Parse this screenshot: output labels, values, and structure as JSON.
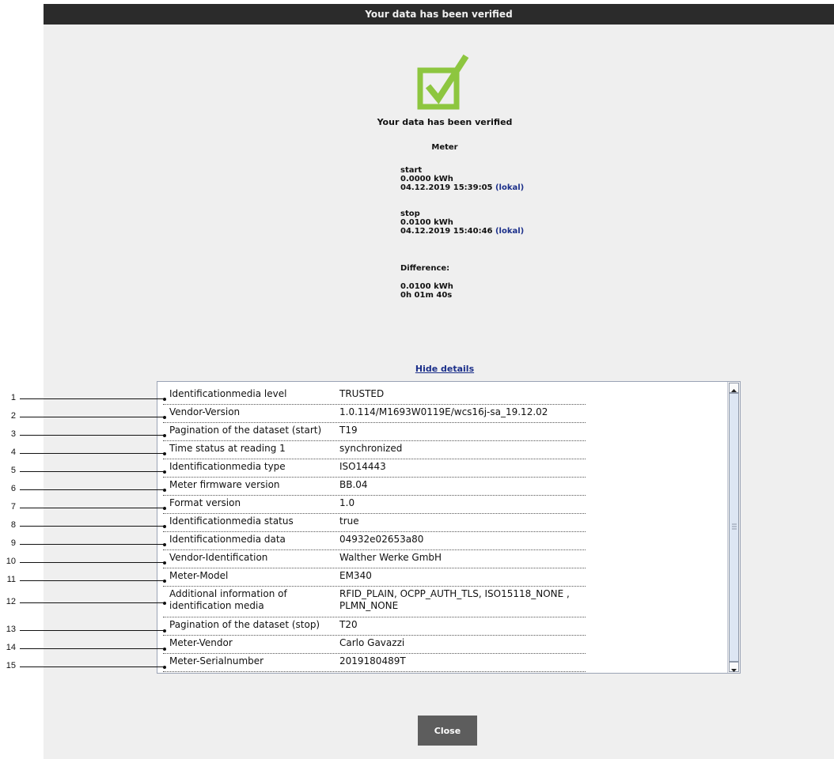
{
  "window": {
    "title": "Your data has been verified"
  },
  "verification": {
    "status_text": "Your data has been verified",
    "meter_heading": "Meter",
    "start": {
      "label": "start",
      "value": "0.0000 kWh",
      "timestamp": "04.12.2019 15:39:05",
      "tz": "(lokal)"
    },
    "stop": {
      "label": "stop",
      "value": "0.0100 kWh",
      "timestamp": "04.12.2019 15:40:46",
      "tz": "(lokal)"
    },
    "difference": {
      "label": "Difference:",
      "energy": "0.0100 kWh",
      "duration": "0h 01m 40s"
    }
  },
  "details": {
    "toggle_label": "Hide details",
    "rows": [
      {
        "label": "Identificationmedia level",
        "value": "TRUSTED"
      },
      {
        "label": "Vendor-Version",
        "value": "1.0.114/M1693W0119E/wcs16j-sa_19.12.02"
      },
      {
        "label": "Pagination of the dataset (start)",
        "value": "T19"
      },
      {
        "label": "Time status at reading 1",
        "value": "synchronized"
      },
      {
        "label": "Identificationmedia type",
        "value": "ISO14443"
      },
      {
        "label": "Meter firmware version",
        "value": "BB.04"
      },
      {
        "label": "Format version",
        "value": "1.0"
      },
      {
        "label": "Identificationmedia status",
        "value": "true"
      },
      {
        "label": "Identificationmedia data",
        "value": "04932e02653a80"
      },
      {
        "label": "Vendor-Identification",
        "value": "Walther Werke GmbH"
      },
      {
        "label": "Meter-Model",
        "value": "EM340"
      },
      {
        "label": "Additional information of identification media",
        "value": "RFID_PLAIN, OCPP_AUTH_TLS, ISO15118_NONE , PLMN_NONE"
      },
      {
        "label": "Pagination of the dataset (stop)",
        "value": "T20"
      },
      {
        "label": "Meter-Vendor",
        "value": "Carlo Gavazzi"
      },
      {
        "label": "Meter-Serialnumber",
        "value": "2019180489T"
      }
    ]
  },
  "callouts": [
    "1",
    "2",
    "3",
    "4",
    "5",
    "6",
    "7",
    "8",
    "9",
    "10",
    "11",
    "12",
    "13",
    "14",
    "15"
  ],
  "buttons": {
    "close_label": "Close"
  },
  "icons": {
    "check": "checkbox-checked-icon",
    "scroll_up": "scroll-up-arrow-icon",
    "scroll_down": "scroll-down-arrow-icon"
  },
  "colors": {
    "accent_green": "#8dc63f",
    "link_blue": "#1b2f8a",
    "titlebar": "#2b2b2b",
    "button": "#5d5d5d"
  }
}
